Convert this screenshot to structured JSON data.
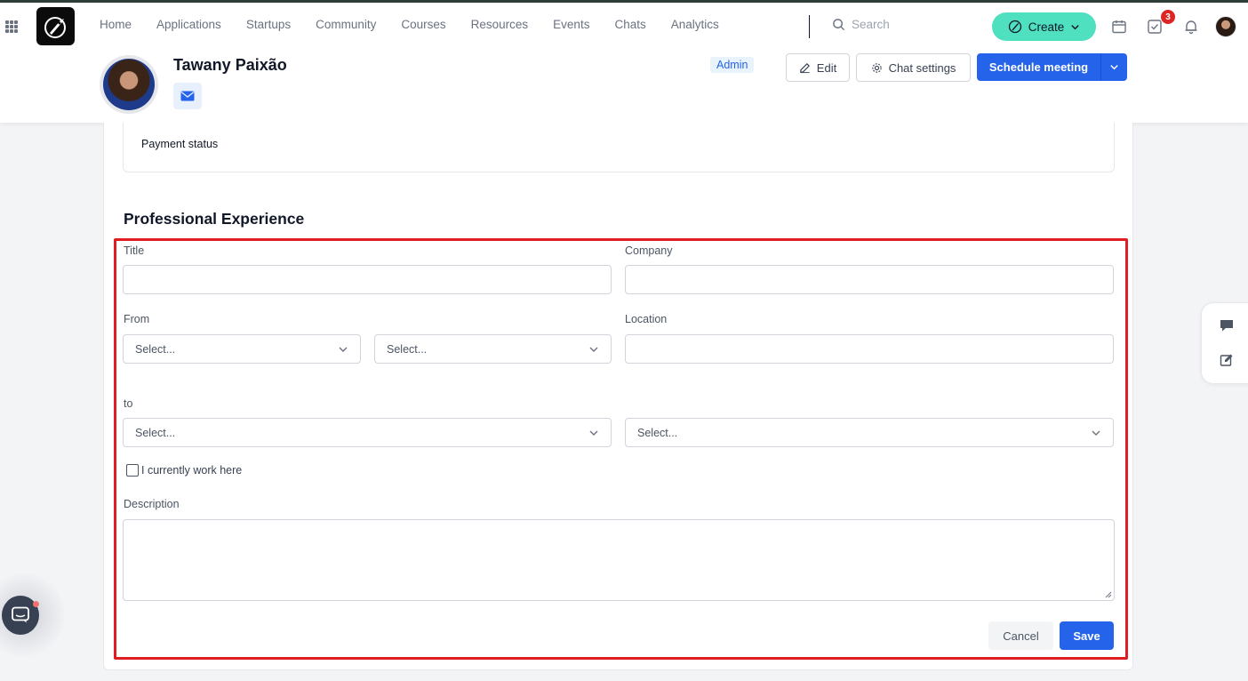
{
  "nav": {
    "items": [
      "Home",
      "Applications",
      "Startups",
      "Community",
      "Courses",
      "Resources",
      "Events",
      "Chats",
      "Analytics"
    ],
    "search_placeholder": "Search",
    "create_label": "Create",
    "tasks_badge": "3"
  },
  "profile": {
    "name": "Tawany Paixão",
    "role_tag": "Admin",
    "edit_label": "Edit",
    "chat_settings_label": "Chat settings",
    "schedule_label": "Schedule meeting"
  },
  "payment": {
    "label": "Payment status"
  },
  "experience": {
    "section_title": "Professional Experience",
    "title_label": "Title",
    "title_value": "",
    "company_label": "Company",
    "company_value": "",
    "from_label": "From",
    "from_month": "Select...",
    "from_year": "Select...",
    "location_label": "Location",
    "location_value": "",
    "to_label": "to",
    "to_month": "Select...",
    "to_year": "Select...",
    "current_label": "I currently work here",
    "description_label": "Description",
    "cancel_label": "Cancel",
    "save_label": "Save"
  },
  "colors": {
    "primary": "#2563eb",
    "create": "#4ee0bf",
    "highlight": "#e11d24"
  }
}
